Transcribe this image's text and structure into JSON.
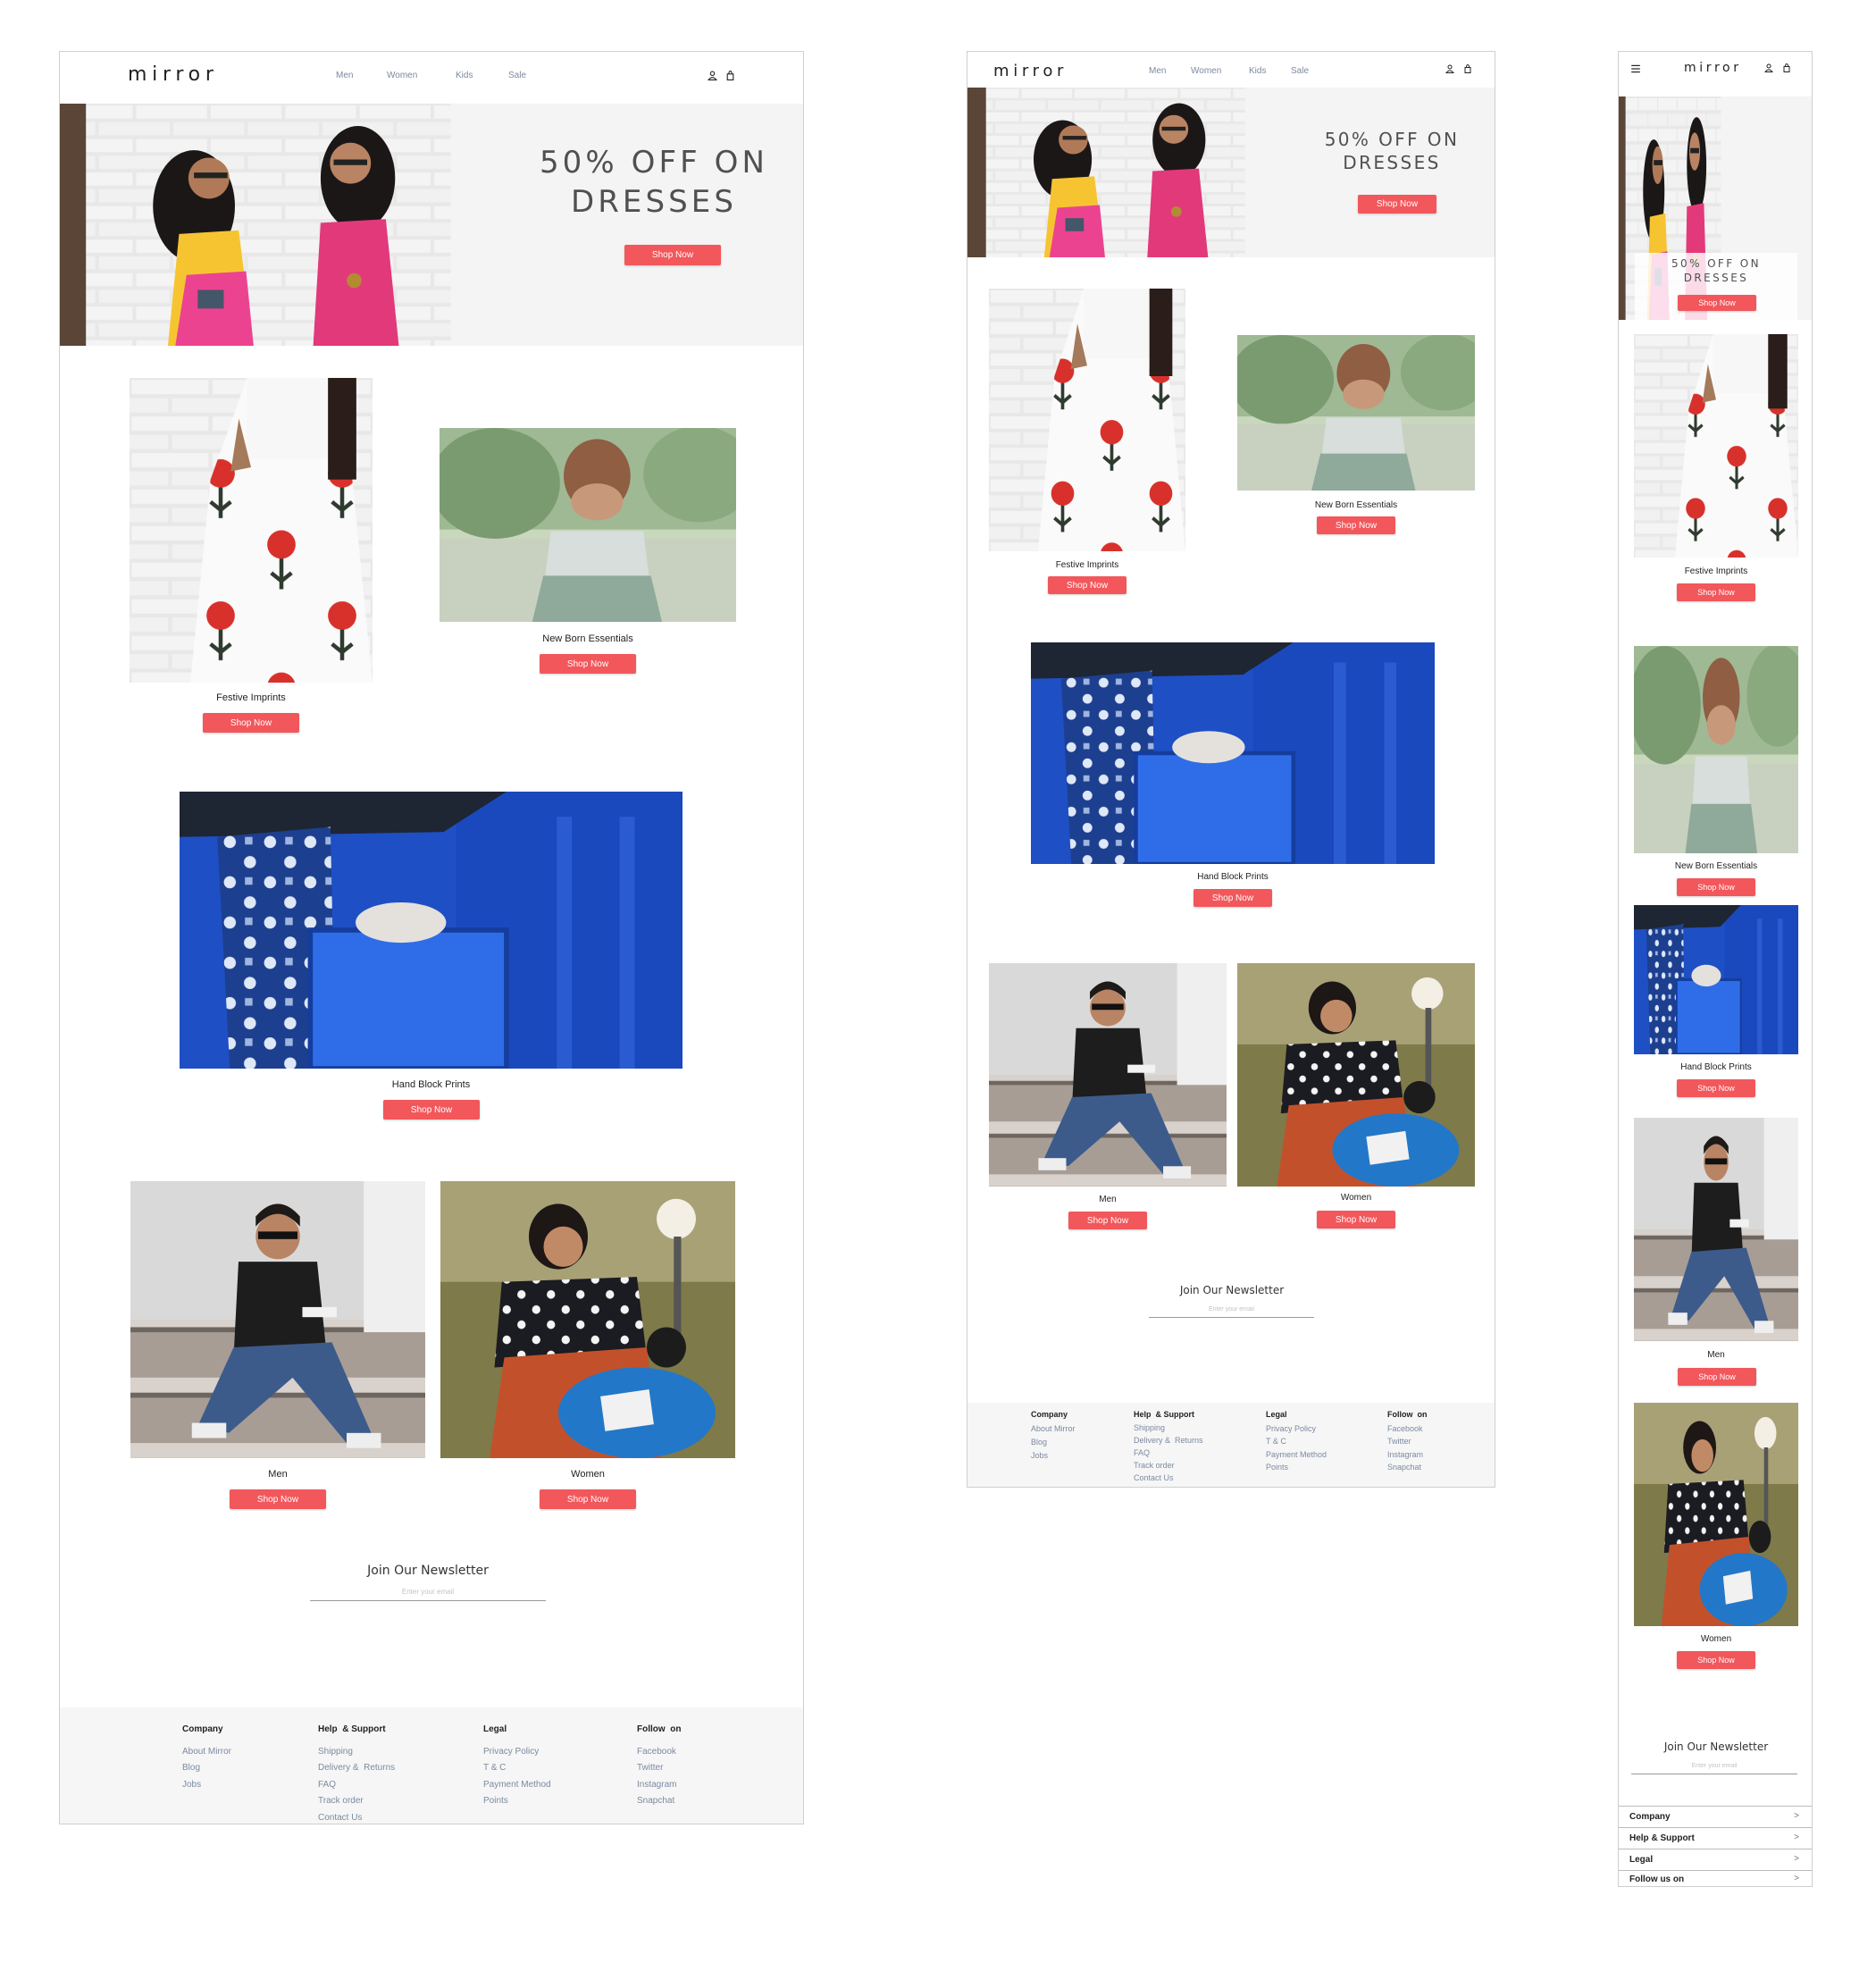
{
  "brand": "mirror",
  "nav": [
    "Men",
    "Women",
    "Kids",
    "Sale"
  ],
  "hero": {
    "title": "50% OFF ON\nDRESSES",
    "cta": "Shop Now"
  },
  "products": [
    {
      "caption": "Festive Imprints",
      "cta": "Shop Now"
    },
    {
      "caption": "New Born Essentials",
      "cta": "Shop Now"
    },
    {
      "caption": "Hand Block Prints",
      "cta": "Shop Now"
    },
    {
      "caption": "Men",
      "cta": "Shop Now"
    },
    {
      "caption": "Women",
      "cta": "Shop Now"
    }
  ],
  "newsletter": {
    "title": "Join Our Newsletter",
    "placeholder": "Enter your email"
  },
  "footer": {
    "columns": [
      {
        "heading": "Company",
        "links": [
          "About Mirror",
          "Blog",
          "Jobs"
        ]
      },
      {
        "heading": "Help  & Support",
        "links": [
          "Shipping",
          "Delivery &  Returns",
          "FAQ",
          "Track order",
          "Contact Us"
        ]
      },
      {
        "heading": "Legal",
        "links": [
          "Privacy Policy",
          "T & C",
          "Payment Method",
          "Points"
        ]
      },
      {
        "heading": "Follow  on",
        "links": [
          "Facebook",
          "Twitter",
          "Instagram",
          "Snapchat"
        ]
      }
    ]
  },
  "mobile_footer": [
    "Company",
    "Help & Support",
    "Legal",
    "Follow us on"
  ],
  "mobile_chevron": ">",
  "colors": {
    "accent": "#f2575b",
    "link": "#7b8aa0",
    "footer_bg": "#f6f6f6"
  },
  "icons": [
    "user-icon",
    "bag-icon",
    "hamburger-icon"
  ]
}
